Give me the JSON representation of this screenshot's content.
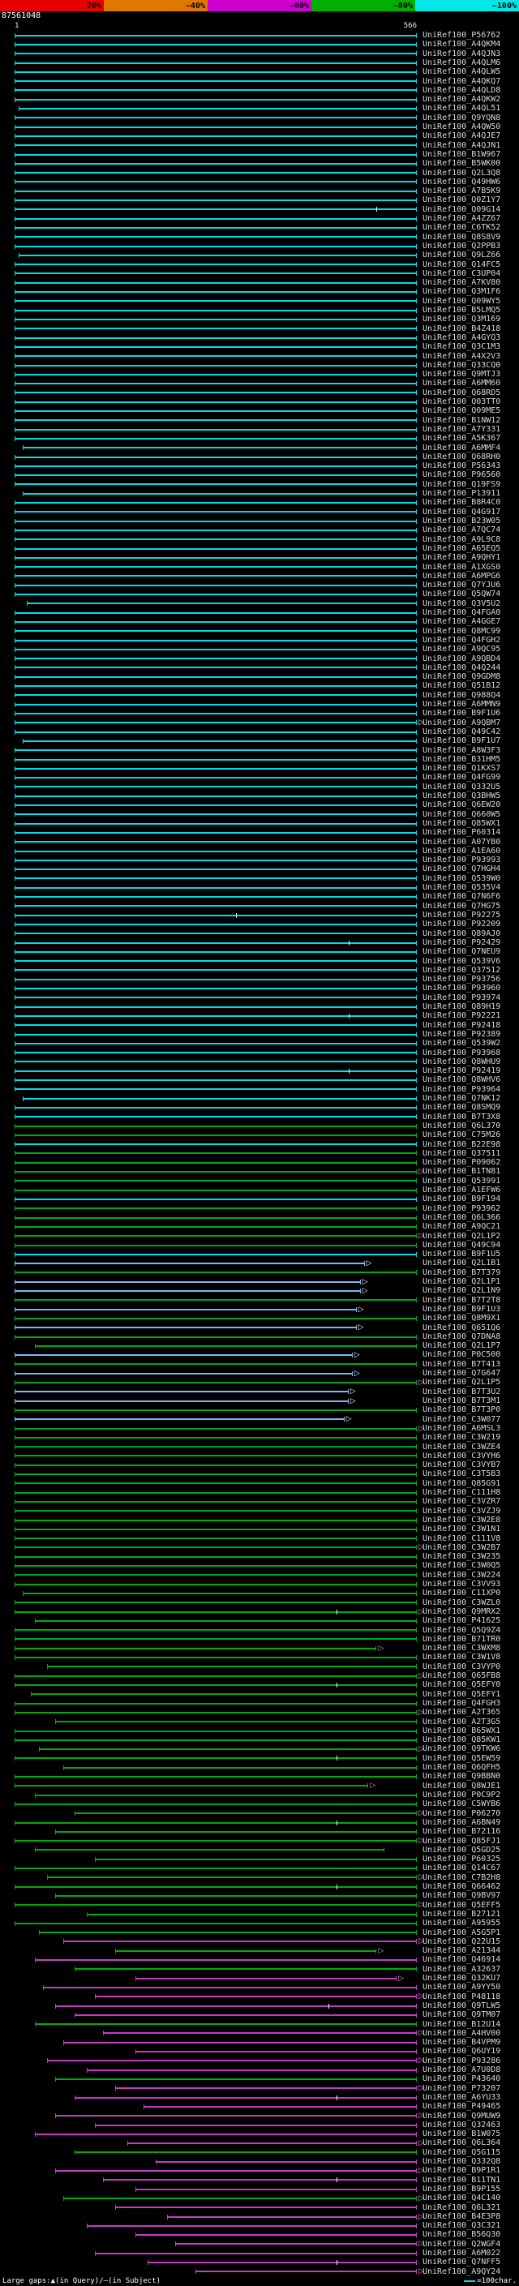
{
  "header": {
    "query_id": "87561048"
  },
  "footer": {
    "gaps_label": "Large gaps:▲(in Query)/—(in Subject)",
    "unit_label": "=100char.",
    "unit_swatch_color": "#00e0e0"
  },
  "rows_meta": {
    "label_prefix": "UniRef100_",
    "colors": {
      "c": "#00dce8",
      "b": "#7ab8f0",
      "g": "#00aa10",
      "m": "#c63bc6"
    },
    "arrow_colors": {
      "c": "#e8e8e8",
      "b": "#ffffff",
      "g": "#ef8fef",
      "m": "#ef8fef"
    }
  },
  "chart_data": {
    "type": "bar",
    "orientation": "horizontal",
    "title": "BLAST hit distribution overview (identity-colored alignment bars vs query)",
    "x_axis": {
      "start": 1,
      "end": 566,
      "start_label": "1",
      "end_label": "566"
    },
    "identity_scale": [
      {
        "label": "20%",
        "color": "#e80000"
      },
      {
        "label": "~40%",
        "color": "#e07800"
      },
      {
        "label": "~60%",
        "color": "#d000d0"
      },
      {
        "label": "~80%",
        "color": "#00b000"
      },
      {
        "label": "~100%",
        "color": "#00e8e8"
      }
    ],
    "series_columns": [
      "accession_suffix",
      "query_start_frac",
      "query_end_frac",
      "identity_class(c=~100,b=~90,g=~80,m=~60)",
      "right_arrow",
      "tick_positions"
    ],
    "series": [
      [
        "P56762",
        0,
        1,
        "c"
      ],
      [
        "A4QKM4",
        0,
        1,
        "c"
      ],
      [
        "A4QJN3",
        0,
        1,
        "c"
      ],
      [
        "A4QLM6",
        0,
        1,
        "c"
      ],
      [
        "A4QLW5",
        0,
        1,
        "c"
      ],
      [
        "A4QKQ7",
        0,
        1,
        "c"
      ],
      [
        "A4QLD8",
        0,
        1,
        "c"
      ],
      [
        "A4QKW2",
        0,
        1,
        "c"
      ],
      [
        "A4QL51",
        0.01,
        1,
        "c"
      ],
      [
        "Q9YQN8",
        0,
        1,
        "c"
      ],
      [
        "A4QW50",
        0,
        1,
        "c"
      ],
      [
        "A4QJE7",
        0,
        1,
        "c"
      ],
      [
        "A4QJN1",
        0,
        1,
        "c"
      ],
      [
        "B1W967",
        0,
        1,
        "c"
      ],
      [
        "B5WK00",
        0,
        1,
        "c"
      ],
      [
        "Q2L3Q8",
        0,
        1,
        "c"
      ],
      [
        "Q49HW6",
        0,
        1,
        "c"
      ],
      [
        "A7B5K9",
        0,
        1,
        "c"
      ],
      [
        "Q0Z1Y7",
        0,
        1,
        "c"
      ],
      [
        "Q09G14",
        0,
        1,
        "c",
        0,
        [
          0.9
        ]
      ],
      [
        "A4ZZ67",
        0,
        1,
        "c"
      ],
      [
        "C6TK52",
        0,
        1,
        "c"
      ],
      [
        "Q8S8V9",
        0,
        1,
        "c"
      ],
      [
        "Q2PPB3",
        0,
        1,
        "c"
      ],
      [
        "Q9LZ66",
        0.01,
        1,
        "c"
      ],
      [
        "Q14FC5",
        0,
        1,
        "c"
      ],
      [
        "C3UP04",
        0,
        1,
        "c"
      ],
      [
        "A7KV80",
        0,
        1,
        "c"
      ],
      [
        "Q3M1F6",
        0,
        1,
        "c"
      ],
      [
        "Q09WY5",
        0,
        1,
        "c"
      ],
      [
        "B5LMQ5",
        0,
        1,
        "c"
      ],
      [
        "Q3M169",
        0,
        1,
        "c"
      ],
      [
        "B4Z418",
        0,
        1,
        "c"
      ],
      [
        "A4GYQ3",
        0,
        1,
        "c"
      ],
      [
        "Q3C1M3",
        0,
        1,
        "c"
      ],
      [
        "A4X2V3",
        0,
        1,
        "c"
      ],
      [
        "Q33CQ0",
        0,
        1,
        "c"
      ],
      [
        "Q9MTJ3",
        0,
        1,
        "c"
      ],
      [
        "A6MM60",
        0,
        1,
        "c"
      ],
      [
        "Q68RD5",
        0,
        1,
        "c"
      ],
      [
        "Q03TT0",
        0,
        1,
        "c"
      ],
      [
        "Q09ME5",
        0,
        1,
        "c"
      ],
      [
        "B1NW12",
        0,
        1,
        "c"
      ],
      [
        "A7Y331",
        0,
        1,
        "c"
      ],
      [
        "A5K367",
        0,
        1,
        "c"
      ],
      [
        "A6MMF4",
        0.02,
        1,
        "c"
      ],
      [
        "Q68RH0",
        0,
        1,
        "c"
      ],
      [
        "P56343",
        0,
        1,
        "c"
      ],
      [
        "P96560",
        0,
        1,
        "c"
      ],
      [
        "Q19FS9",
        0,
        1,
        "c"
      ],
      [
        "P13911",
        0.02,
        1,
        "c"
      ],
      [
        "B8R4C0",
        0,
        1,
        "c"
      ],
      [
        "Q4G917",
        0,
        1,
        "c"
      ],
      [
        "B23W05",
        0,
        1,
        "c"
      ],
      [
        "A7QC74",
        0,
        1,
        "c"
      ],
      [
        "A9L9C8",
        0,
        1,
        "c"
      ],
      [
        "A65EQ5",
        0,
        1,
        "c"
      ],
      [
        "A9QHY1",
        0,
        1,
        "c"
      ],
      [
        "A1XGS0",
        0,
        1,
        "c"
      ],
      [
        "A6MPG6",
        0,
        1,
        "c"
      ],
      [
        "Q7YJU6",
        0,
        1,
        "c"
      ],
      [
        "Q5QW74",
        0,
        1,
        "c"
      ],
      [
        "Q3V5U2",
        0.03,
        1,
        "c"
      ],
      [
        "Q4FGA0",
        0,
        1,
        "c"
      ],
      [
        "A4GGE7",
        0,
        1,
        "c"
      ],
      [
        "Q8MC99",
        0,
        1,
        "c"
      ],
      [
        "Q4FGH2",
        0,
        1,
        "c"
      ],
      [
        "A9QC95",
        0,
        1,
        "c"
      ],
      [
        "A9QBD4",
        0,
        1,
        "c"
      ],
      [
        "Q4Q244",
        0,
        1,
        "c"
      ],
      [
        "Q9GDM8",
        0,
        1,
        "c"
      ],
      [
        "Q51B12",
        0,
        1,
        "c"
      ],
      [
        "Q988Q4",
        0,
        1,
        "c"
      ],
      [
        "A6MMN9",
        0,
        1,
        "c"
      ],
      [
        "B9F1U6",
        0,
        1,
        "c"
      ],
      [
        "A9QBM7",
        0,
        1,
        "c",
        1
      ],
      [
        "Q49C42",
        0,
        1,
        "c"
      ],
      [
        "B9F1U7",
        0.02,
        1,
        "c"
      ],
      [
        "A8W3F3",
        0,
        1,
        "c"
      ],
      [
        "B31HM5",
        0,
        1,
        "c"
      ],
      [
        "Q1KXS7",
        0,
        1,
        "c"
      ],
      [
        "Q4FG99",
        0,
        1,
        "c"
      ],
      [
        "Q332U5",
        0,
        1,
        "c"
      ],
      [
        "Q3BHW5",
        0,
        1,
        "c"
      ],
      [
        "Q6EW20",
        0,
        1,
        "c"
      ],
      [
        "Q660W5",
        0,
        1,
        "c"
      ],
      [
        "Q85WX1",
        0,
        1,
        "c"
      ],
      [
        "P60314",
        0,
        1,
        "c"
      ],
      [
        "A07YB0",
        0,
        1,
        "c"
      ],
      [
        "A1EA60",
        0,
        1,
        "c"
      ],
      [
        "P93993",
        0,
        1,
        "c"
      ],
      [
        "Q7HGH4",
        0,
        1,
        "c"
      ],
      [
        "Q539W0",
        0,
        1,
        "c"
      ],
      [
        "Q535V4",
        0,
        1,
        "c"
      ],
      [
        "Q7N6F6",
        0,
        1,
        "c"
      ],
      [
        "Q7HG75",
        0,
        1,
        "c"
      ],
      [
        "P92275",
        0,
        1,
        "c",
        0,
        [
          0.55
        ]
      ],
      [
        "P92209",
        0,
        1,
        "c"
      ],
      [
        "Q89AJ0",
        0,
        1,
        "c"
      ],
      [
        "P92429",
        0,
        1,
        "c",
        0,
        [
          0.83
        ]
      ],
      [
        "Q7NEU9",
        0,
        1,
        "c"
      ],
      [
        "Q539V6",
        0,
        1,
        "c"
      ],
      [
        "Q37512",
        0,
        1,
        "c"
      ],
      [
        "P93756",
        0,
        1,
        "c"
      ],
      [
        "P93960",
        0,
        1,
        "c"
      ],
      [
        "P93974",
        0,
        1,
        "c"
      ],
      [
        "Q89H19",
        0,
        1,
        "c"
      ],
      [
        "P92221",
        0,
        1,
        "c",
        0,
        [
          0.83
        ]
      ],
      [
        "P92418",
        0,
        1,
        "c"
      ],
      [
        "P92389",
        0,
        1,
        "c"
      ],
      [
        "Q539W2",
        0,
        1,
        "c"
      ],
      [
        "P93968",
        0,
        1,
        "c"
      ],
      [
        "Q8WHU9",
        0,
        1,
        "c"
      ],
      [
        "P92419",
        0,
        1,
        "c",
        0,
        [
          0.83
        ]
      ],
      [
        "Q8WHV6",
        0,
        1,
        "c"
      ],
      [
        "P93964",
        0,
        1,
        "c"
      ],
      [
        "Q7NK12",
        0.02,
        1,
        "c"
      ],
      [
        "Q8SMQ9",
        0,
        1,
        "c"
      ],
      [
        "B7T3X8",
        0,
        1,
        "c"
      ],
      [
        "Q6L370",
        0,
        1,
        "g"
      ],
      [
        "C75M26",
        0,
        1,
        "g"
      ],
      [
        "B22E98",
        0,
        1,
        "c"
      ],
      [
        "Q37511",
        0,
        1,
        "g"
      ],
      [
        "P09062",
        0,
        1,
        "g"
      ],
      [
        "B1TN81",
        0,
        1,
        "g",
        1
      ],
      [
        "Q53991",
        0,
        1,
        "g"
      ],
      [
        "A1EFW6",
        0,
        1,
        "g"
      ],
      [
        "B9F194",
        0,
        1,
        "c"
      ],
      [
        "P93962",
        0,
        1,
        "g"
      ],
      [
        "Q6L366",
        0,
        1,
        "g"
      ],
      [
        "A9QC21",
        0,
        1,
        "g"
      ],
      [
        "Q2L1P2",
        0,
        1,
        "g",
        1
      ],
      [
        "Q49C94",
        0,
        1,
        "g"
      ],
      [
        "B9F1U5",
        0,
        1,
        "c"
      ],
      [
        "Q2L1B1",
        0,
        0.87,
        "b",
        1
      ],
      [
        "B7T379",
        0,
        1,
        "g"
      ],
      [
        "Q2L1P1",
        0,
        0.86,
        "b",
        1
      ],
      [
        "Q2L1N9",
        0,
        0.86,
        "b",
        1
      ],
      [
        "B7T2T8",
        0,
        1,
        "g"
      ],
      [
        "B9F1U3",
        0,
        0.85,
        "b",
        1
      ],
      [
        "Q8M9X1",
        0,
        1,
        "g"
      ],
      [
        "Q651Q6",
        0,
        0.85,
        "b",
        1
      ],
      [
        "Q7DNA8",
        0,
        1,
        "g"
      ],
      [
        "Q2L1P7",
        0.05,
        1,
        "g"
      ],
      [
        "P0C500",
        0,
        0.84,
        "b",
        1
      ],
      [
        "B7T413",
        0,
        1,
        "g"
      ],
      [
        "Q7G647",
        0,
        0.84,
        "b",
        1
      ],
      [
        "Q2L1P5",
        0,
        1,
        "g",
        1
      ],
      [
        "B7T3U2",
        0,
        0.83,
        "b",
        1
      ],
      [
        "B7T3M1",
        0,
        0.83,
        "b",
        1
      ],
      [
        "B7T3P0",
        0,
        1,
        "g"
      ],
      [
        "C3W077",
        0,
        0.82,
        "b",
        1
      ],
      [
        "A6MSL3",
        0,
        1,
        "g",
        1
      ],
      [
        "C3W219",
        0,
        1,
        "g"
      ],
      [
        "C3WZE4",
        0,
        1,
        "g"
      ],
      [
        "C3VYH6",
        0,
        1,
        "g"
      ],
      [
        "C3VYB7",
        0,
        1,
        "g"
      ],
      [
        "C3T5B3",
        0,
        1,
        "g"
      ],
      [
        "Q85G91",
        0,
        1,
        "g"
      ],
      [
        "C111H8",
        0,
        1,
        "g"
      ],
      [
        "C3VZR7",
        0,
        1,
        "g"
      ],
      [
        "C3VZJ9",
        0,
        1,
        "g"
      ],
      [
        "C3W2E8",
        0,
        1,
        "g"
      ],
      [
        "C3W1N1",
        0,
        1,
        "g"
      ],
      [
        "C111V8",
        0,
        1,
        "g"
      ],
      [
        "C3W2B7",
        0,
        1,
        "g",
        1
      ],
      [
        "C3W235",
        0,
        1,
        "g"
      ],
      [
        "C3W0Q5",
        0,
        1,
        "g"
      ],
      [
        "C3W224",
        0,
        1,
        "g"
      ],
      [
        "C3VV93",
        0,
        1,
        "g"
      ],
      [
        "C11XP0",
        0.02,
        1,
        "g"
      ],
      [
        "C3WZL0",
        0,
        1,
        "g"
      ],
      [
        "Q9MRX2",
        0,
        1,
        "g",
        1,
        [
          0.8
        ]
      ],
      [
        "P41625",
        0.05,
        1,
        "g"
      ],
      [
        "Q5Q9Z4",
        0,
        1,
        "g"
      ],
      [
        "B71TR0",
        0,
        1,
        "g"
      ],
      [
        "C3WXM8",
        0,
        0.9,
        "g",
        1
      ],
      [
        "C3W1V8",
        0,
        1,
        "g"
      ],
      [
        "C3VYP0",
        0.08,
        1,
        "g"
      ],
      [
        "Q65FB8",
        0,
        1,
        "g",
        1
      ],
      [
        "Q5EFY0",
        0,
        1,
        "g",
        0,
        [
          0.8
        ]
      ],
      [
        "Q5EFY1",
        0.04,
        1,
        "g"
      ],
      [
        "Q4FGH3",
        0,
        1,
        "g"
      ],
      [
        "A2T365",
        0,
        1,
        "g",
        1
      ],
      [
        "A2T3G5",
        0.1,
        1,
        "g"
      ],
      [
        "B65WX1",
        0,
        1,
        "g"
      ],
      [
        "Q85KW1",
        0,
        1,
        "g"
      ],
      [
        "Q9TKW6",
        0.06,
        1,
        "g",
        1
      ],
      [
        "Q5EW59",
        0,
        1,
        "g",
        0,
        [
          0.8
        ]
      ],
      [
        "Q6QFH5",
        0.12,
        1,
        "g"
      ],
      [
        "Q9BBN0",
        0,
        1,
        "g"
      ],
      [
        "Q8WJE1",
        0,
        0.88,
        "g",
        1
      ],
      [
        "P0C9P2",
        0.05,
        1,
        "g"
      ],
      [
        "C5WYB6",
        0,
        1,
        "g"
      ],
      [
        "P06270",
        0.15,
        1,
        "g",
        1
      ],
      [
        "A6BN49",
        0,
        1,
        "g",
        0,
        [
          0.8
        ]
      ],
      [
        "B72116",
        0.1,
        1,
        "g"
      ],
      [
        "Q85FJ1",
        0,
        1,
        "g",
        1
      ],
      [
        "Q5GD25",
        0.05,
        0.92,
        "g"
      ],
      [
        "P60325",
        0.2,
        1,
        "g"
      ],
      [
        "Q14C67",
        0,
        1,
        "g"
      ],
      [
        "C7B2H8",
        0.08,
        1,
        "g",
        1
      ],
      [
        "Q66462",
        0,
        1,
        "g",
        0,
        [
          0.8
        ]
      ],
      [
        "Q9BV97",
        0.1,
        1,
        "g"
      ],
      [
        "Q5EFF5",
        0,
        1,
        "g",
        1
      ],
      [
        "B27121",
        0.18,
        1,
        "g"
      ],
      [
        "A95955",
        0,
        1,
        "g"
      ],
      [
        "A5G5P1",
        0.06,
        1,
        "g"
      ],
      [
        "Q22U15",
        0.12,
        1,
        "m",
        1
      ],
      [
        "A21344",
        0.25,
        0.9,
        "g",
        1
      ],
      [
        "Q46914",
        0.05,
        1,
        "m"
      ],
      [
        "A32637",
        0.15,
        1,
        "g"
      ],
      [
        "Q32KU7",
        0.3,
        0.95,
        "m",
        1
      ],
      [
        "A9YY50",
        0.07,
        1,
        "m"
      ],
      [
        "P48118",
        0.2,
        1,
        "m",
        1
      ],
      [
        "Q9TLW5",
        0.1,
        1,
        "m",
        0,
        [
          0.78
        ]
      ],
      [
        "Q9TM07",
        0.15,
        1,
        "m"
      ],
      [
        "B12U14",
        0.05,
        1,
        "g"
      ],
      [
        "A4HV00",
        0.22,
        1,
        "m",
        1
      ],
      [
        "B4VPM9",
        0.12,
        1,
        "m"
      ],
      [
        "Q6UY19",
        0.3,
        1,
        "m"
      ],
      [
        "P93286",
        0.08,
        1,
        "m",
        1
      ],
      [
        "A7U0D8",
        0.18,
        1,
        "m"
      ],
      [
        "P43640",
        0.1,
        1,
        "g"
      ],
      [
        "P73207",
        0.25,
        1,
        "m",
        1
      ],
      [
        "A6YU33",
        0.15,
        1,
        "m",
        0,
        [
          0.8
        ]
      ],
      [
        "P49465",
        0.32,
        1,
        "m"
      ],
      [
        "Q9MUW9",
        0.1,
        1,
        "m",
        1
      ],
      [
        "Q32463",
        0.2,
        1,
        "m"
      ],
      [
        "B1W075",
        0.05,
        1,
        "m"
      ],
      [
        "Q6L364",
        0.28,
        1,
        "m",
        1
      ],
      [
        "Q5G115",
        0.15,
        1,
        "g"
      ],
      [
        "Q332Q8",
        0.35,
        1,
        "m"
      ],
      [
        "B9P1R1",
        0.1,
        1,
        "m",
        1
      ],
      [
        "B11TN1",
        0.22,
        1,
        "m",
        0,
        [
          0.8
        ]
      ],
      [
        "B9P155",
        0.3,
        1,
        "m"
      ],
      [
        "Q4C140",
        0.12,
        1,
        "g",
        1
      ],
      [
        "Q6L321",
        0.25,
        1,
        "m"
      ],
      [
        "B4E3P8",
        0.38,
        1,
        "m",
        1
      ],
      [
        "Q3C321",
        0.18,
        1,
        "m"
      ],
      [
        "B56Q30",
        0.3,
        1,
        "m"
      ],
      [
        "Q2WGF4",
        0.4,
        1,
        "m",
        1
      ],
      [
        "A6M022",
        0.2,
        1,
        "m"
      ],
      [
        "Q7NFF5",
        0.33,
        1,
        "m",
        0,
        [
          0.8
        ]
      ],
      [
        "A9QY24",
        0.45,
        1,
        "m",
        1
      ]
    ]
  }
}
